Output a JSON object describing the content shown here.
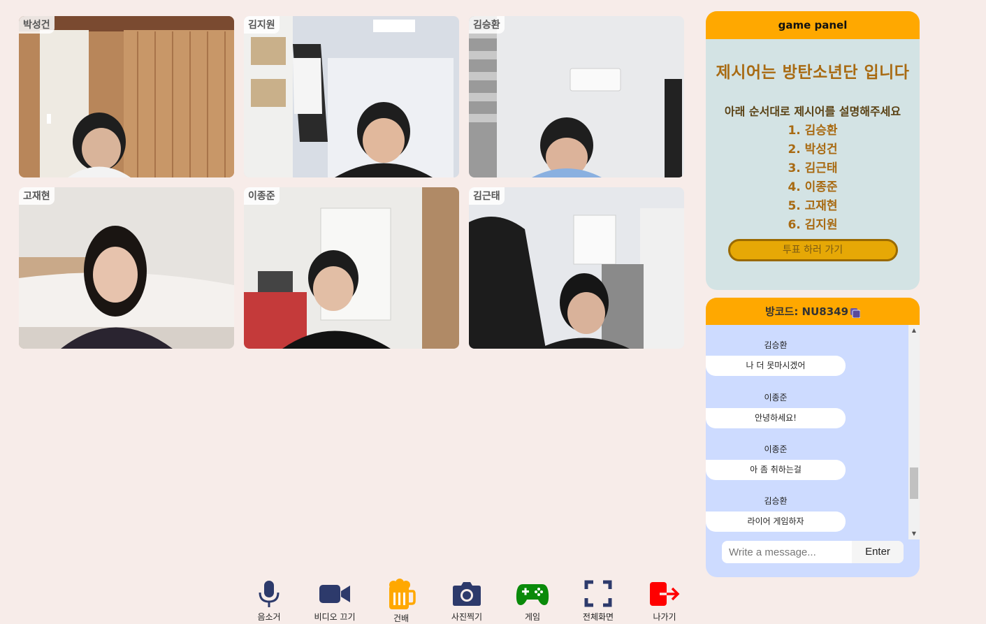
{
  "participants": [
    {
      "name": "박성건"
    },
    {
      "name": "김지원"
    },
    {
      "name": "김승환"
    },
    {
      "name": "고재현"
    },
    {
      "name": "이종준"
    },
    {
      "name": "김근태"
    }
  ],
  "game_panel": {
    "title": "game panel",
    "keyword_text": "제시어는 방탄소년단 입니다",
    "instruction": "아래 순서대로 제시어를 설명해주세요",
    "order": [
      "1. 김승환",
      "2. 박성건",
      "3. 김근태",
      "4. 이종준",
      "5. 고재현",
      "6. 김지원"
    ],
    "vote_button": "투표 하러 가기"
  },
  "chat": {
    "room_code": "방코드: NU8349",
    "messages": [
      {
        "sender": "김승환",
        "text": "나 더 못마시겠어"
      },
      {
        "sender": "이종준",
        "text": "안녕하세요!"
      },
      {
        "sender": "이종준",
        "text": "아 좀 취하는걸"
      },
      {
        "sender": "김승환",
        "text": "라이어 게임하자"
      }
    ],
    "input_placeholder": "Write a message...",
    "enter_label": "Enter"
  },
  "toolbar": [
    {
      "label": "음소거",
      "icon": "microphone-icon",
      "color": "#2d3a6b"
    },
    {
      "label": "비디오 끄기",
      "icon": "video-camera-icon",
      "color": "#2d3a6b"
    },
    {
      "label": "건배",
      "icon": "beer-mug-icon",
      "color": "#ffa800"
    },
    {
      "label": "사진찍기",
      "icon": "camera-icon",
      "color": "#2d3a6b"
    },
    {
      "label": "게임",
      "icon": "gamepad-icon",
      "color": "#0a8a0a"
    },
    {
      "label": "전체화면",
      "icon": "fullscreen-icon",
      "color": "#2d3a6b"
    },
    {
      "label": "나가기",
      "icon": "exit-icon",
      "color": "#ff0000"
    }
  ],
  "colors": {
    "accent": "#ffa800",
    "background": "#f7ece9",
    "game_panel_bg": "#d3e3e4",
    "chat_bg": "#cddbff"
  }
}
